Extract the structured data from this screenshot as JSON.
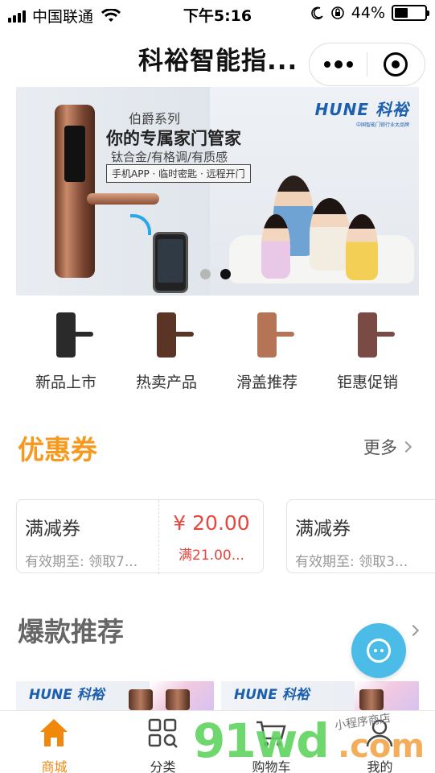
{
  "status_bar": {
    "carrier": "中国联通",
    "time": "下午5:16",
    "battery_percent": "44%",
    "battery_level": 0.44
  },
  "nav": {
    "title": "科裕智能指..."
  },
  "banner": {
    "series": "伯爵系列",
    "headline": "你的专属家门管家",
    "subline": "钛合金/有格调/有质感",
    "tagline": "手机APP · 临时密匙 · 远程开门",
    "brand_logo": "HUNE 科裕",
    "brand_slogan": "中国智能门锁行业太品牌",
    "slide_count": 2,
    "active_slide": 2
  },
  "categories": [
    {
      "label": "新品上市",
      "color": "#2a2a2a"
    },
    {
      "label": "热卖产品",
      "color": "#5a3526"
    },
    {
      "label": "滑盖推荐",
      "color": "#b47455"
    },
    {
      "label": "钜惠促销",
      "color": "#7a4a44"
    }
  ],
  "coupons_section": {
    "title": "优惠券",
    "title_color": "#f59a1e",
    "more_label": "更多"
  },
  "coupons": [
    {
      "title": "满减券",
      "validity": "有效期至: 领取7...",
      "price": "¥ 20.00",
      "condition": "满21.00..."
    },
    {
      "title": "满减券",
      "validity": "有效期至: 领取3..."
    }
  ],
  "hot_section": {
    "title": "爆款推荐",
    "title_color": "#666666"
  },
  "products": [
    {
      "logo": "HUNE 科裕"
    },
    {
      "logo": "HUNE 科裕"
    }
  ],
  "tabbar": {
    "items": [
      {
        "label": "商城",
        "icon": "home-icon",
        "active": true
      },
      {
        "label": "分类",
        "icon": "category-icon",
        "active": false
      },
      {
        "label": "购物车",
        "icon": "cart-icon",
        "active": false
      },
      {
        "label": "我的",
        "icon": "user-icon",
        "active": false
      }
    ],
    "accent": "#f0880c"
  },
  "watermark": {
    "main": "91wd",
    "domain": ".com",
    "script": "小程序商店"
  }
}
